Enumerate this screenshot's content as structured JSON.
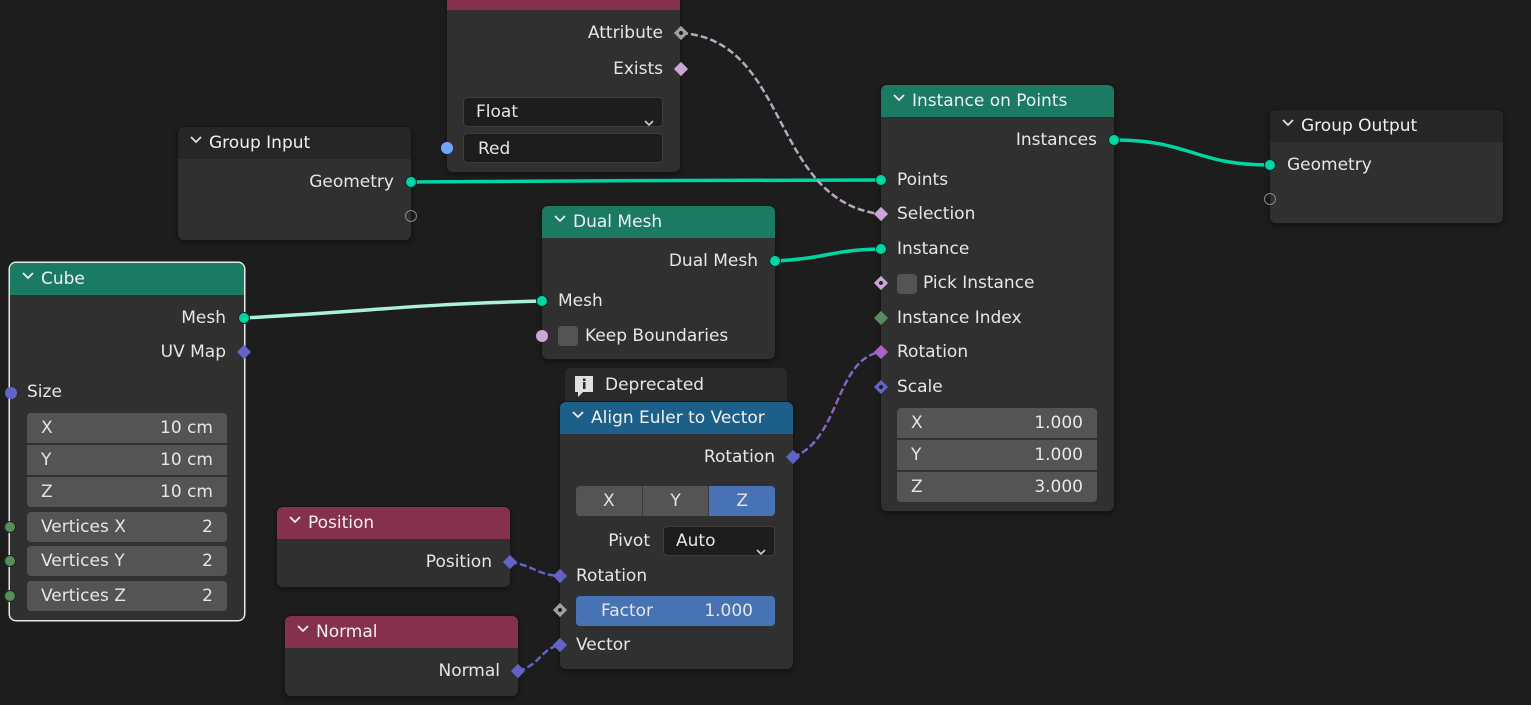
{
  "nodes": {
    "named_attribute": {
      "outputs": {
        "attribute": "Attribute",
        "exists": "Exists"
      },
      "data_type": "Float",
      "name_value": "Red"
    },
    "group_input": {
      "title": "Group Input",
      "outputs": {
        "geometry": "Geometry"
      }
    },
    "dual_mesh": {
      "title": "Dual Mesh",
      "output": "Dual Mesh",
      "inputs": {
        "mesh": "Mesh",
        "keep_boundaries": "Keep Boundaries"
      }
    },
    "cube": {
      "title": "Cube",
      "outputs": {
        "mesh": "Mesh",
        "uv_map": "UV Map"
      },
      "size_label": "Size",
      "size": [
        {
          "axis": "X",
          "value": "10 cm"
        },
        {
          "axis": "Y",
          "value": "10 cm"
        },
        {
          "axis": "Z",
          "value": "10 cm"
        }
      ],
      "vertices": [
        {
          "label": "Vertices X",
          "value": "2"
        },
        {
          "label": "Vertices Y",
          "value": "2"
        },
        {
          "label": "Vertices Z",
          "value": "2"
        }
      ]
    },
    "instance_on_points": {
      "title": "Instance on Points",
      "output": "Instances",
      "inputs": {
        "points": "Points",
        "selection": "Selection",
        "instance": "Instance",
        "pick_instance": "Pick Instance",
        "instance_index": "Instance Index",
        "rotation": "Rotation",
        "scale": "Scale"
      },
      "scale": [
        {
          "axis": "X",
          "value": "1.000"
        },
        {
          "axis": "Y",
          "value": "1.000"
        },
        {
          "axis": "Z",
          "value": "3.000"
        }
      ]
    },
    "group_output": {
      "title": "Group Output",
      "inputs": {
        "geometry": "Geometry"
      }
    },
    "align_euler": {
      "warning": "Deprecated",
      "title": "Align Euler to Vector",
      "output": "Rotation",
      "axis_options": [
        "X",
        "Y",
        "Z"
      ],
      "axis_selected": "Z",
      "pivot_label": "Pivot",
      "pivot_value": "Auto",
      "inputs": {
        "rotation": "Rotation",
        "vector": "Vector"
      },
      "factor_label": "Factor",
      "factor_value": "1.000"
    },
    "position": {
      "title": "Position",
      "output": "Position"
    },
    "normal": {
      "title": "Normal",
      "output": "Normal"
    }
  },
  "colors": {
    "geometry_socket": "#00d6a3",
    "vector_socket": "#6363c7",
    "boolean_socket": "#cca6d6",
    "integer_socket": "#598c5c",
    "geometry_header": "#1b7a62",
    "input_header": "#85304c",
    "vector_header": "#1c5f88",
    "selected_accent": "#4772b3",
    "background": "#1d1d1d"
  }
}
